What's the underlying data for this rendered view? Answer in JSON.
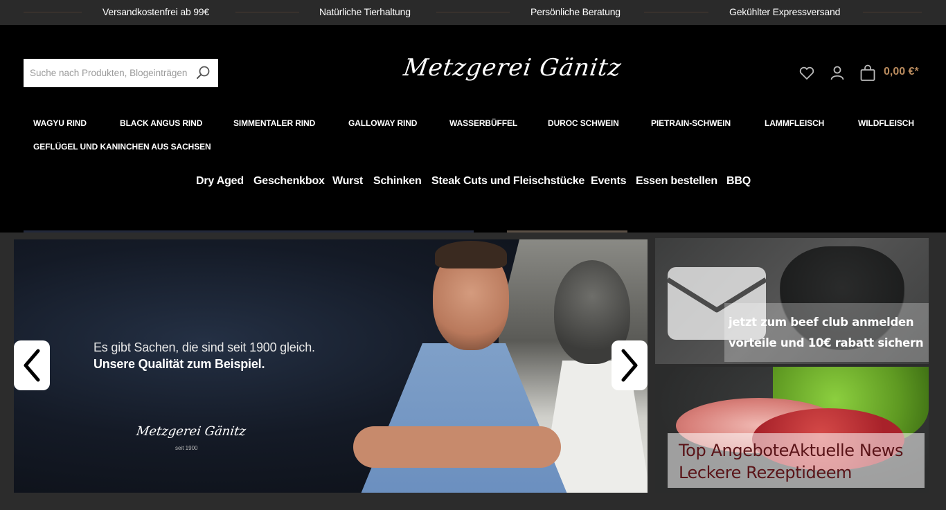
{
  "usp_bar": {
    "items": [
      "Versandkostenfrei ab 99€",
      "Natürliche Tierhaltung",
      "Persönliche Beratung",
      "Gekühlter Expressversand"
    ]
  },
  "header": {
    "search": {
      "placeholder": "Suche nach Produkten, Blogeinträgen ...",
      "icon": "search-icon"
    },
    "logo": "Metzgerei Gänitz",
    "icons": [
      "heart-icon",
      "user-icon",
      "shopping-bag-icon"
    ],
    "cart_total": "0,00 €*"
  },
  "categories": [
    "Wagyu Rind",
    "Black Angus Rind",
    "Simmentaler Rind",
    "Galloway Rind",
    "Wasserbüffel",
    "Duroc Schwein",
    "Pietrain-Schwein",
    "Lammfleisch",
    "Wildfleisch",
    "Geflügel und Kaninchen aus Sachsen"
  ],
  "subnav": [
    "Dry Aged",
    "Geschenkbox",
    "Wurst",
    "Schinken",
    "Steak Cuts und Fleischstücke",
    "Events",
    "Essen bestellen",
    "BBQ"
  ],
  "slider": {
    "line1": "Es gibt Sachen, die sind seit 1900 gleich.",
    "line2": "Unsere Qualität zum Beispiel.",
    "logo": "Metzgerei Gänitz",
    "est": "seit 1900",
    "prev_icon": "chevron-left-icon",
    "next_icon": "chevron-right-icon"
  },
  "teasers": {
    "beef_club": {
      "line1": "jetzt zum beef club anmelden",
      "line2": "vorteile und 10€ rabatt sichern !",
      "icon": "envelope-icon"
    },
    "offers": {
      "line1": "Top AngeboteAktuelle News",
      "line2": "Leckere Rezeptideem"
    }
  },
  "colors": {
    "accent": "#b98b5e",
    "header_bg": "#000000",
    "usp_bg": "#2a2a2a",
    "teaser_text": "#5a1418"
  }
}
